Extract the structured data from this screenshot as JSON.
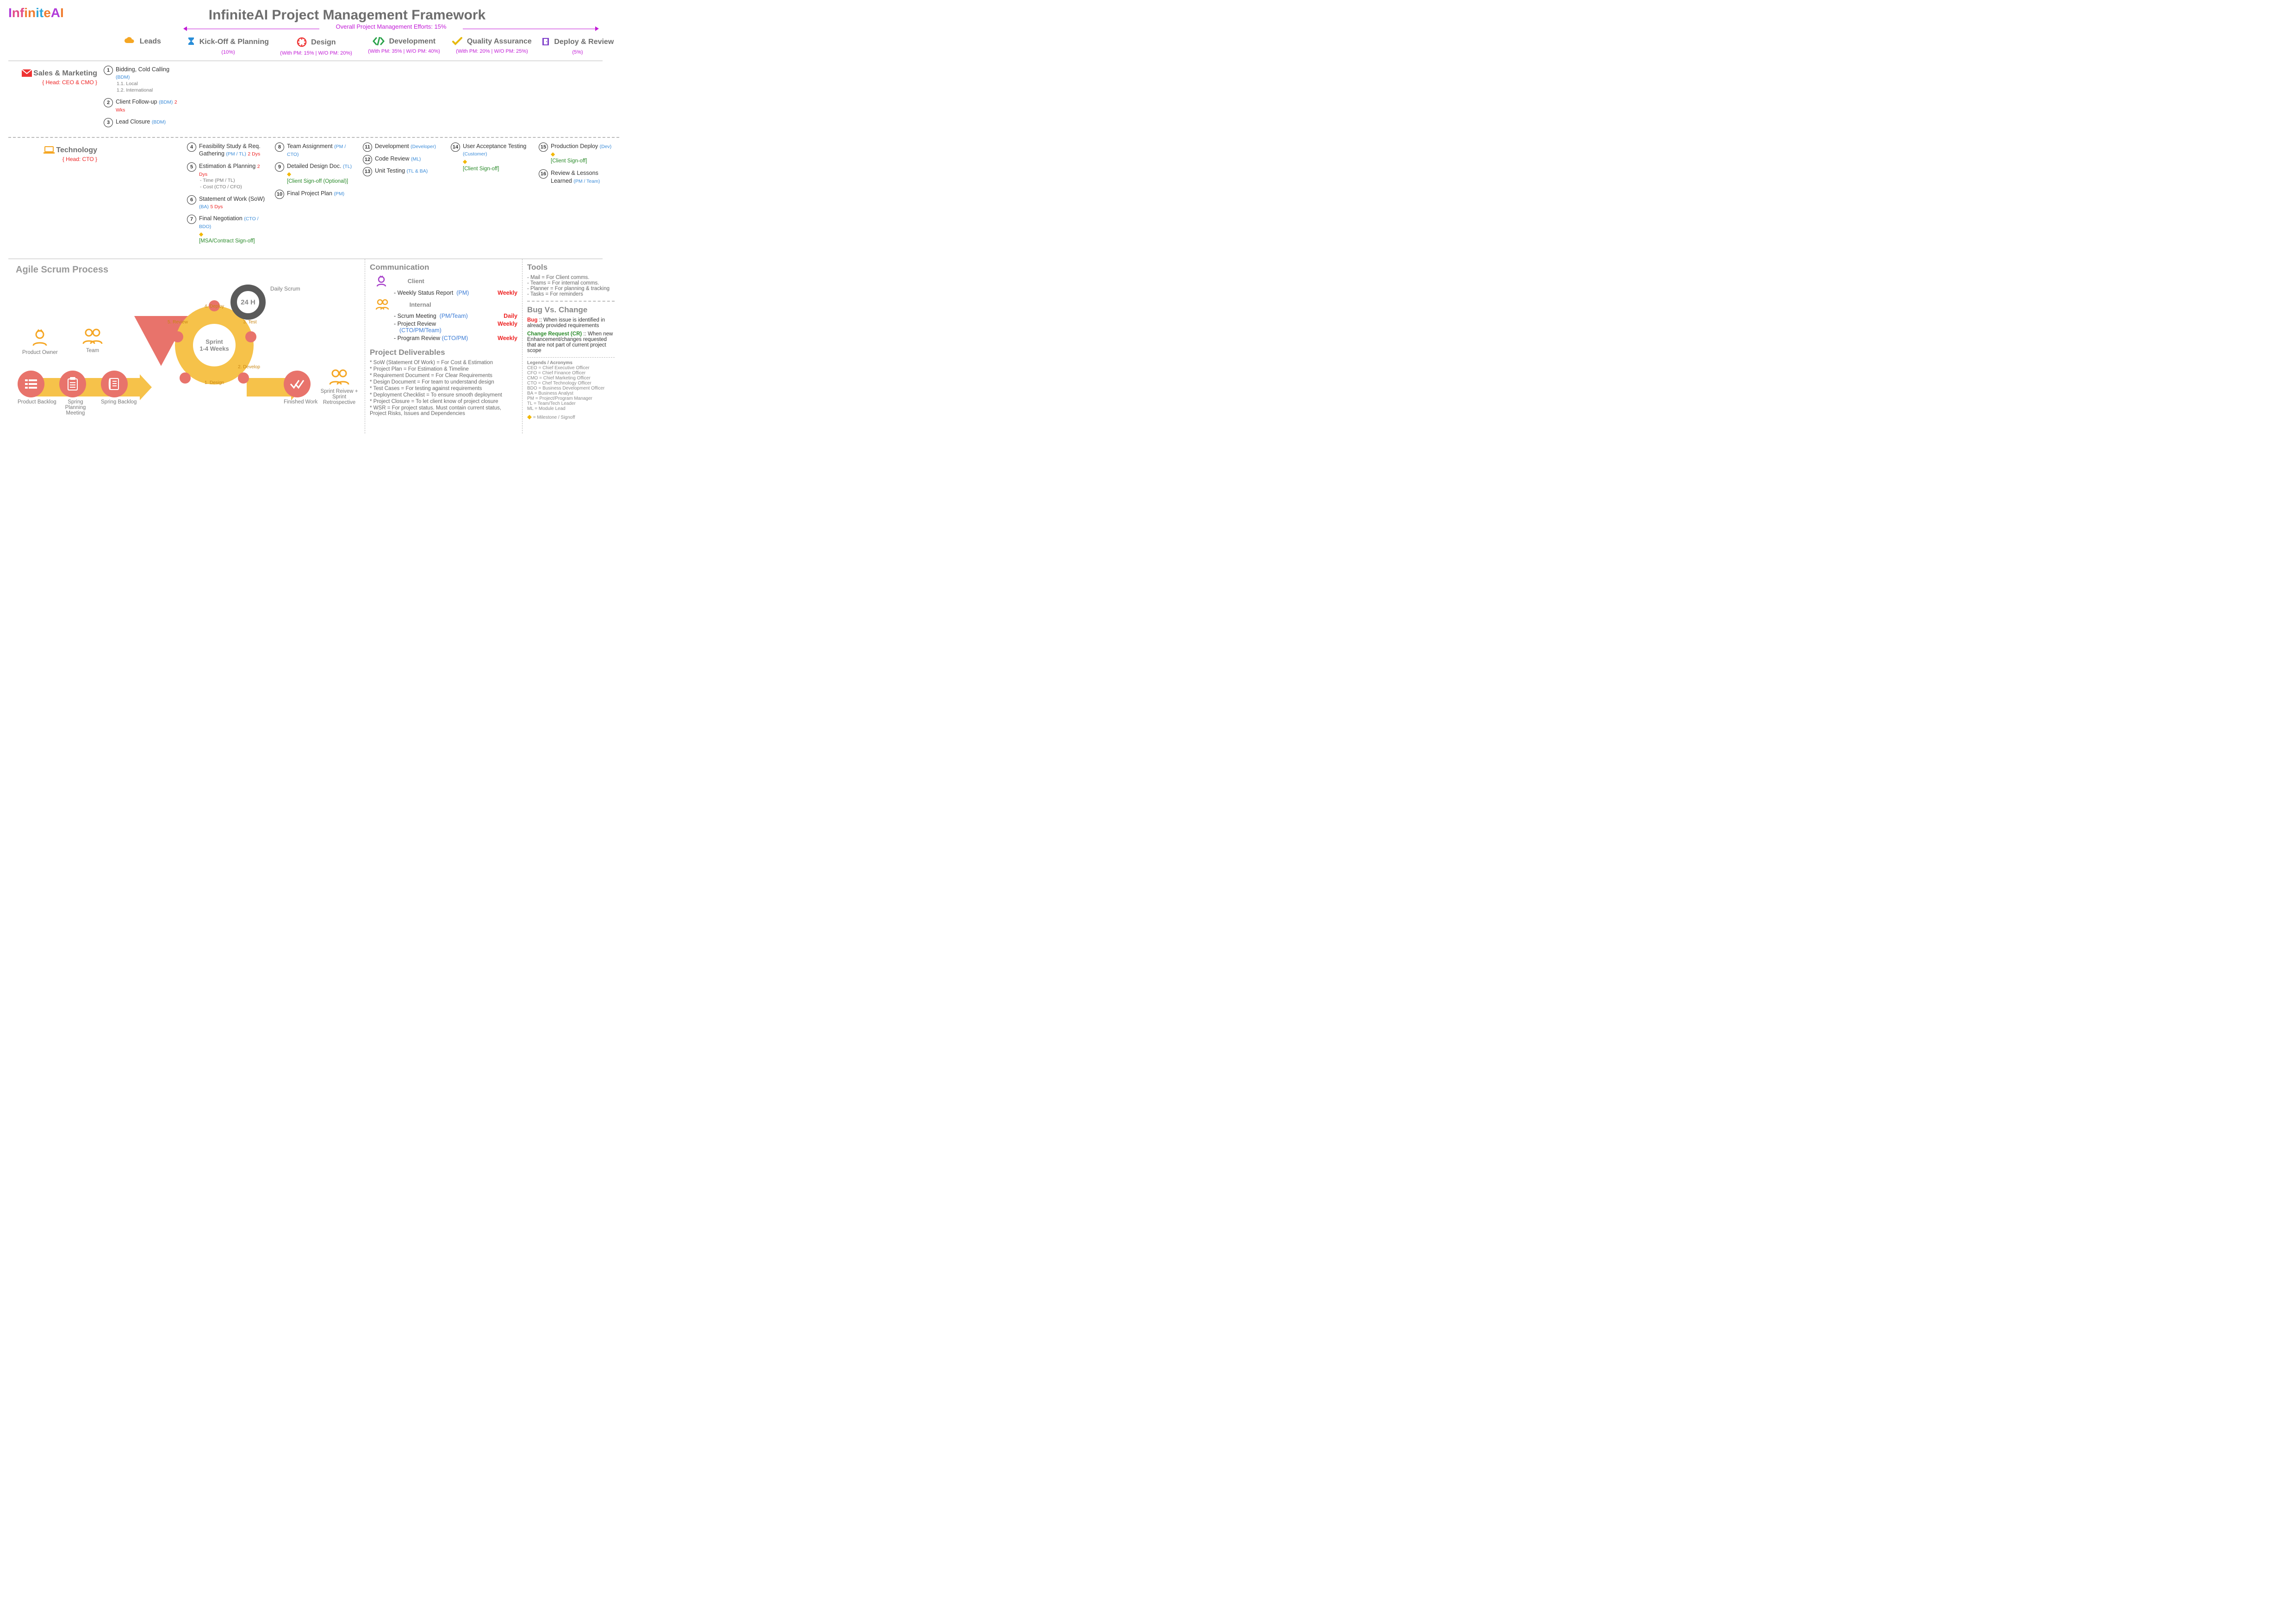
{
  "brand": {
    "name": "InfiniteAI",
    "colors": [
      "#b03ad8",
      "#e24b88",
      "#f07c2e",
      "#2fa6d8"
    ]
  },
  "title": "InfiniteAI Project Management Framework",
  "pm_efforts_label": "Overall Project Management Efforts: 15%",
  "phases": [
    {
      "key": "leads",
      "label": "Leads",
      "sub": "",
      "icon": "cloud",
      "iconColor": "#f5a623"
    },
    {
      "key": "kickoff",
      "label": "Kick-Off & Planning",
      "sub": "(10%)",
      "icon": "hourglass",
      "iconColor": "#2a8ed8"
    },
    {
      "key": "design",
      "label": "Design",
      "sub": "(With PM: 15% | W/O PM: 20%)",
      "icon": "hexring",
      "iconColor": "#e33"
    },
    {
      "key": "dev",
      "label": "Development",
      "sub": "(With PM: 35% | W/O PM: 40%)",
      "icon": "code",
      "iconColor": "#2aa24a"
    },
    {
      "key": "qa",
      "label": "Quality Assurance",
      "sub": "(With PM: 20% | W/O PM: 25%)",
      "icon": "check",
      "iconColor": "#e6b90f"
    },
    {
      "key": "deploy",
      "label": "Deploy & Review",
      "sub": "(5%)",
      "icon": "door",
      "iconColor": "#7e3fc9"
    }
  ],
  "lanes": [
    {
      "key": "sales",
      "title": "Sales & Marketing",
      "head": "{ Head: CEO & CMO }",
      "icon": "mail",
      "iconColor": "#e33"
    },
    {
      "key": "tech",
      "title": "Technology",
      "head": "{ Head: CTO }",
      "icon": "laptop",
      "iconColor": "#f5a623"
    }
  ],
  "cells": {
    "sales": {
      "leads": [
        {
          "n": "1",
          "text": "Bidding, Cold Calling",
          "who": "(BDM)",
          "sub": "1.1. Local\n1.2. International"
        },
        {
          "n": "2",
          "text": "Client Follow-up",
          "who": "(BDM)",
          "dur": "2 Wks"
        },
        {
          "n": "3",
          "text": "Lead Closure",
          "who": "(BDM)"
        }
      ]
    },
    "tech": {
      "kickoff": [
        {
          "n": "4",
          "text": "Feasibility Study & Req. Gathering",
          "who": "(PM / TL)",
          "dur": "2 Dys"
        },
        {
          "n": "5",
          "text": "Estimation & Planning",
          "sub": "  - Time (PM / TL)\n  - Cost (CTO / CFO)",
          "dur": "2 Dys"
        },
        {
          "n": "6",
          "text": "Statement of Work (SoW)",
          "who": "(BA)",
          "dur": "5 Dys"
        },
        {
          "n": "7",
          "text": "Final Negotiation",
          "who": "(CTO / BDO)",
          "signoff": "[MSA/Contract Sign-off]",
          "milestone": true
        }
      ],
      "design": [
        {
          "n": "8",
          "text": "Team Assignment",
          "who": "(PM / CTO)"
        },
        {
          "n": "9",
          "text": "Detailed Design Doc.",
          "who": "(TL)",
          "signoff": "[Client Sign-off (Optional)]",
          "milestone": true
        },
        {
          "n": "10",
          "text": "Final Project Plan",
          "who": "(PM)"
        }
      ],
      "dev": [
        {
          "n": "11",
          "text": "Development",
          "who": "(Developer)"
        },
        {
          "n": "12",
          "text": "Code Review",
          "who": "(ML)"
        },
        {
          "n": "13",
          "text": "Unit Testing",
          "who": "(TL & BA)"
        }
      ],
      "qa": [
        {
          "n": "14",
          "text": "User Acceptance Testing",
          "who": "(Customer)",
          "signoff": "[Client Sign-off]",
          "milestone": true
        }
      ],
      "deploy": [
        {
          "n": "15",
          "text": "Production Deploy",
          "who": "(Dev)",
          "signoff": "[Client Sign-off]",
          "milestone": true
        },
        {
          "n": "16",
          "text": "Review & Lessons Learned",
          "who": "(PM / Team)"
        }
      ]
    }
  },
  "agile": {
    "title": "Agile Scrum Process",
    "daily_scrum_label": "Daily Scrum",
    "daily_scrum_value": "24 H",
    "sprint_label": "Sprint",
    "sprint_duration": "1-4 Weeks",
    "ring_steps": [
      "1. Design",
      "2. Develop",
      "3. Test",
      "4. Deploy",
      "5. Review"
    ],
    "items": [
      {
        "key": "product-owner",
        "label": "Product Owner"
      },
      {
        "key": "team",
        "label": "Team"
      },
      {
        "key": "product-backlog",
        "label": "Product Backlog"
      },
      {
        "key": "spring-planning",
        "label": "Spring Planning Meeting"
      },
      {
        "key": "spring-backlog",
        "label": "Spring Backlog"
      },
      {
        "key": "finished-work",
        "label": "Finished Work"
      },
      {
        "key": "sprint-review",
        "label": "Sprint Reivew + Sprint Retrospective"
      }
    ]
  },
  "communication": {
    "title": "Communication",
    "groups": [
      {
        "key": "client",
        "label": "Client",
        "items": [
          {
            "name": "- Weekly Status Report",
            "who": "(PM)",
            "freq": "Weekly"
          }
        ]
      },
      {
        "key": "internal",
        "label": "Internal",
        "items": [
          {
            "name": "- Scrum Meeting",
            "who": "(PM/Team)",
            "freq": "Daily"
          },
          {
            "name": "- Project Review",
            "who": "(CTO/PM/Team)",
            "freq": "Weekly"
          },
          {
            "name": "- Program Review",
            "who": "(CTO/PM)",
            "freq": "Weekly"
          }
        ]
      }
    ]
  },
  "deliverables": {
    "title": "Project Deliverables",
    "items": [
      "* SoW (Statement Of Work) = For Cost & Estimation",
      "* Project Plan = For Estimation & Timeline",
      "* Requirement Document = For Clear Requirements",
      "* Design Document = For team to understand design",
      "* Test Cases = For testing against requirements",
      "* Deployment Checklist = To ensure smooth deployment",
      "* Project Closure = To let client know of project closure",
      "* WSR = For project status. Must contain current status, Project Risks, Issues and Dependencies"
    ]
  },
  "tools": {
    "title": "Tools",
    "items": [
      "- Mail = For Client comms.",
      "- Teams = For internal comms.",
      "- Planner = For planning & tracking",
      "- Tasks = For reminders"
    ]
  },
  "bugvschange": {
    "title": "Bug Vs. Change",
    "bug": "Bug :: When issue is identified in already provided requirements",
    "cr": "Change Request (CR) :: When new Enhancement/changes requested that are not part of current project scope"
  },
  "legends": {
    "title": "Legends / Acronyms",
    "items": [
      "CEO = Chief Executive Officer",
      "CFO = Chief Finance Officer",
      "CMO = Chief Marketing Officer",
      "CTO = Chef Technology Officer",
      "BDO = Business Development Officer",
      "BA = Business Analyst",
      "PM = Project/Program Manager",
      "TL = Team/Tech Leader",
      "ML = Module Lead"
    ],
    "milestone_label": "= Milestone / Signoff"
  }
}
